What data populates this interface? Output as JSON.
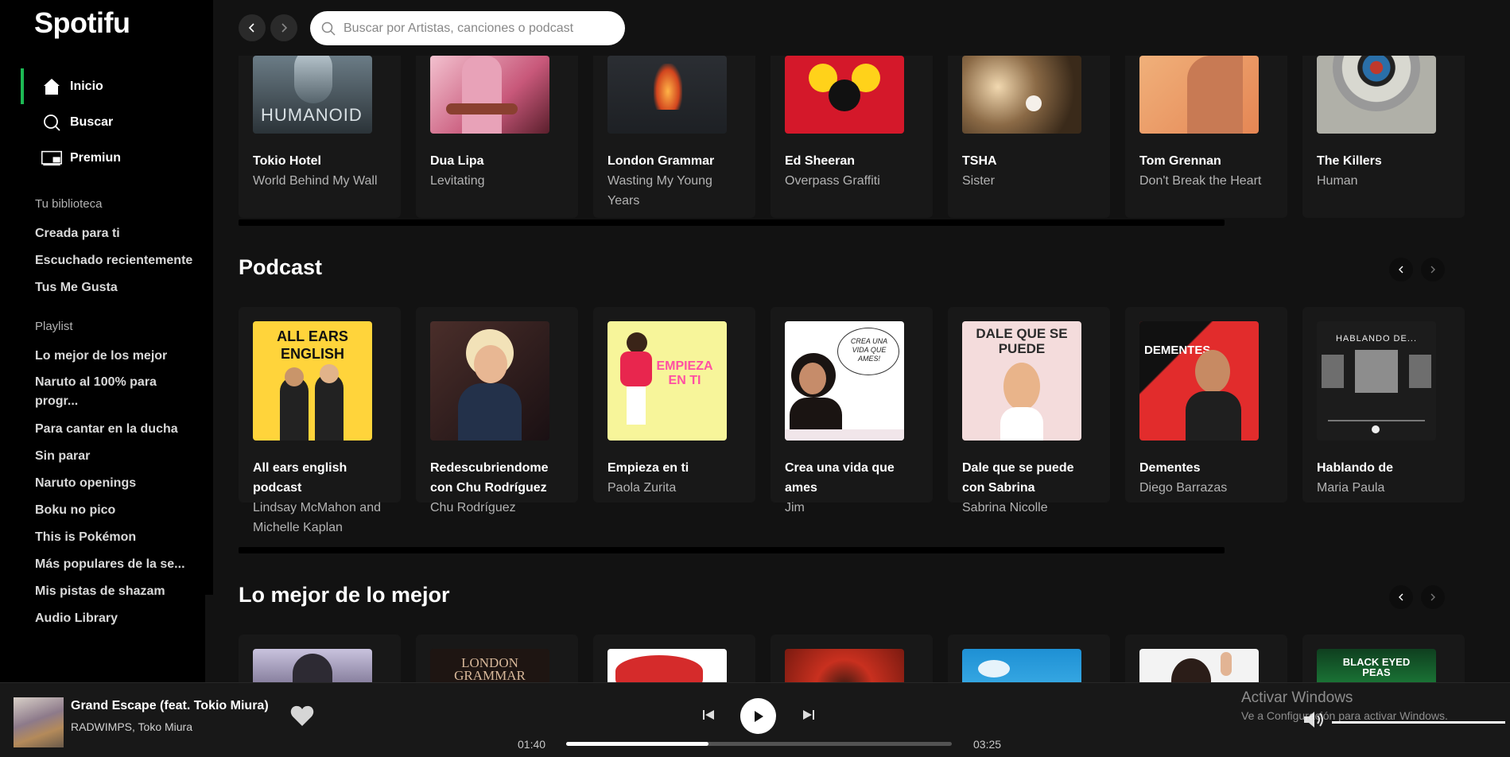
{
  "app": {
    "logo": "Spotifu",
    "accent": "#1db954"
  },
  "nav": [
    {
      "label": "Inicio",
      "icon": "home-icon",
      "active": true
    },
    {
      "label": "Buscar",
      "icon": "search-icon"
    },
    {
      "label": "Premiun",
      "icon": "premium-icon"
    }
  ],
  "library": {
    "heading": "Tu biblioteca",
    "items": [
      "Creada para ti",
      "Escuchado recientemente",
      "Tus Me Gusta"
    ]
  },
  "playlists": {
    "heading": "Playlist",
    "items": [
      "Lo mejor de los mejor",
      "Naruto al 100% para progr...",
      "Para cantar en la ducha",
      "Sin parar",
      "Naruto openings",
      "Boku no pico",
      "This is Pokémon",
      "Más populares de la se...",
      "Mis pistas de shazam",
      "Audio Library"
    ]
  },
  "search": {
    "placeholder": "Buscar por Artistas, canciones o podcast"
  },
  "songs_row": [
    {
      "title": "Tokio Hotel",
      "subtitle": "World Behind My Wall",
      "cover_text": "HUMANOID"
    },
    {
      "title": "Dua Lipa",
      "subtitle": "Levitating"
    },
    {
      "title": "London Grammar",
      "subtitle": "Wasting My Young Years"
    },
    {
      "title": "Ed Sheeran",
      "subtitle": "Overpass Graffiti"
    },
    {
      "title": "TSHA",
      "subtitle": "Sister"
    },
    {
      "title": "Tom Grennan",
      "subtitle": "Don't Break the Heart"
    },
    {
      "title": "The Killers",
      "subtitle": "Human"
    }
  ],
  "podcast_section": {
    "title": "Podcast",
    "items": [
      {
        "title": "All ears english podcast",
        "subtitle": "Lindsay McMahon and Michelle Kaplan",
        "cover_text": "ALL EARS ENGLISH"
      },
      {
        "title": "Redescubriendome con Chu Rodríguez",
        "subtitle": "Chu Rodríguez"
      },
      {
        "title": "Empieza en ti",
        "subtitle": "Paola Zurita",
        "cover_text": "EMPIEZA EN TI"
      },
      {
        "title": "Crea una vida que ames",
        "subtitle": "Jim",
        "cover_text": "CREA UNA VIDA QUE AMES!"
      },
      {
        "title": "Dale que se puede con Sabrina",
        "subtitle": "Sabrina Nicolle",
        "cover_text": "DALE QUE SE PUEDE"
      },
      {
        "title": "Dementes",
        "subtitle": "Diego Barrazas",
        "cover_text": "DEMENTES"
      },
      {
        "title": "Hablando de",
        "subtitle": "Maria Paula",
        "cover_text": "HABLANDO DE..."
      }
    ]
  },
  "best_section": {
    "title": "Lo mejor de lo mejor",
    "covers": [
      "",
      "LONDON GRAMMAR",
      "",
      "",
      "",
      "",
      "BLACK EYED PEAS"
    ]
  },
  "player": {
    "title": "Grand Escape (feat. Tokio Miura)",
    "artist": "RADWIMPS, Toko Miura",
    "elapsed": "01:40",
    "duration": "03:25",
    "progress_fraction": 0.37,
    "volume_fraction": 1.0
  },
  "watermark": {
    "title": "Activar Windows",
    "subtitle": "Ve a Configuración para activar Windows."
  }
}
